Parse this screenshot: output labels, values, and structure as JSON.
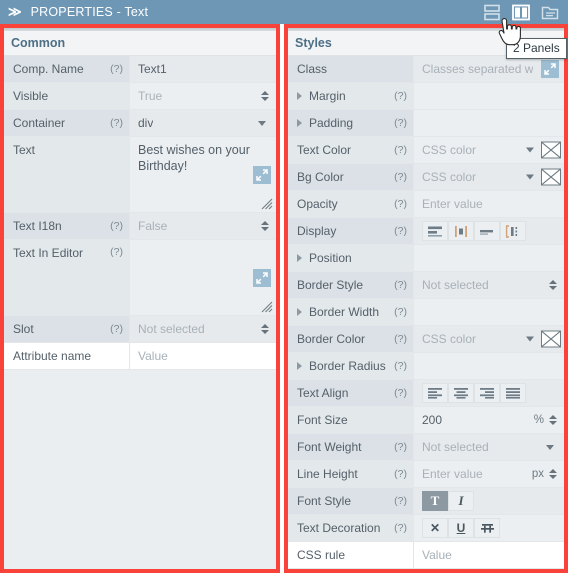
{
  "titlebar": {
    "chevrons": "≫",
    "title": "PROPERTIES - Text",
    "icons": [
      {
        "name": "stacked-panels-icon",
        "label": "1 Panel",
        "active": false
      },
      {
        "name": "two-panels-icon",
        "label": "2 Panels",
        "active": true
      },
      {
        "name": "folder-panels-icon",
        "label": "Folders",
        "active": false
      }
    ]
  },
  "tooltip": {
    "text": "2 Panels"
  },
  "common": {
    "heading": "Common",
    "rows": [
      {
        "label": "Comp. Name",
        "hint": "(?)",
        "value": "Text1",
        "type": "text"
      },
      {
        "label": "Visible",
        "hint": "",
        "value": "True",
        "type": "spinner-placeholder"
      },
      {
        "label": "Container",
        "hint": "(?)",
        "value": "div",
        "type": "select"
      },
      {
        "label": "Text",
        "hint": "",
        "value": "Best wishes on your Birthday!",
        "type": "textarea"
      },
      {
        "label": "Text I18n",
        "hint": "(?)",
        "value": "False",
        "type": "spinner-placeholder"
      },
      {
        "label": "Text In Editor",
        "hint": "(?)",
        "value": "",
        "type": "textarea"
      },
      {
        "label": "Slot",
        "hint": "(?)",
        "value": "Not selected",
        "type": "spinner-placeholder"
      }
    ],
    "attribute_row": {
      "name_placeholder": "Attribute name",
      "value_placeholder": "Value"
    }
  },
  "styles": {
    "heading": "Styles",
    "rows": [
      {
        "label": "Class",
        "hint": "",
        "value": "Classes separated w",
        "type": "text-expand"
      },
      {
        "label": "Margin",
        "hint": "(?)",
        "value": "",
        "type": "group"
      },
      {
        "label": "Padding",
        "hint": "(?)",
        "value": "",
        "type": "group"
      },
      {
        "label": "Text Color",
        "hint": "(?)",
        "value": "CSS color",
        "type": "color"
      },
      {
        "label": "Bg Color",
        "hint": "(?)",
        "value": "CSS color",
        "type": "color"
      },
      {
        "label": "Opacity",
        "hint": "(?)",
        "value": "Enter value",
        "type": "text"
      },
      {
        "label": "Display",
        "hint": "(?)",
        "value": "",
        "type": "icons-display"
      },
      {
        "label": "Position",
        "hint": "",
        "value": "",
        "type": "group"
      },
      {
        "label": "Border Style",
        "hint": "(?)",
        "value": "Not selected",
        "type": "spinner-placeholder"
      },
      {
        "label": "Border Width",
        "hint": "(?)",
        "value": "",
        "type": "group"
      },
      {
        "label": "Border Color",
        "hint": "(?)",
        "value": "CSS color",
        "type": "color"
      },
      {
        "label": "Border Radius",
        "hint": "(?)",
        "value": "",
        "type": "group"
      },
      {
        "label": "Text Align",
        "hint": "(?)",
        "value": "",
        "type": "icons-align"
      },
      {
        "label": "Font Size",
        "hint": "",
        "value": "200",
        "unit": "%",
        "type": "number-unit"
      },
      {
        "label": "Font Weight",
        "hint": "(?)",
        "value": "Not selected",
        "type": "select"
      },
      {
        "label": "Line Height",
        "hint": "(?)",
        "value": "Enter value",
        "unit": "px",
        "type": "number-unit"
      },
      {
        "label": "Font Style",
        "hint": "(?)",
        "value": "",
        "type": "icons-fontstyle"
      },
      {
        "label": "Text Decoration",
        "hint": "(?)",
        "value": "",
        "type": "icons-decoration"
      }
    ],
    "css_rule_row": {
      "name_placeholder": "CSS rule",
      "value_placeholder": "Value"
    },
    "display_buttons": [
      "block-icon",
      "inline-block-icon",
      "inline-icon",
      "flex-icon"
    ],
    "align_buttons": [
      "align-left-icon",
      "align-center-icon",
      "align-right-icon",
      "align-justify-icon"
    ],
    "font_style_buttons": [
      {
        "icon": "normal-text-icon",
        "glyph": "T",
        "active": true
      },
      {
        "icon": "italic-icon",
        "glyph": "I",
        "active": false
      }
    ],
    "decoration_buttons": [
      {
        "icon": "none-decoration-icon",
        "glyph": "✕",
        "active": false
      },
      {
        "icon": "underline-icon",
        "glyph": "U",
        "active": false
      },
      {
        "icon": "line-through-icon",
        "glyph": "–",
        "active": false
      }
    ]
  },
  "colors": {
    "titlebar": "#6d97b5",
    "frame_highlight": "#f8423a",
    "label_bg": "#dbe1e6",
    "value_bg": "#e6eaed",
    "text": "#54606a",
    "placeholder": "#a8b1b8",
    "expand_icon": "#9cbdd2"
  }
}
